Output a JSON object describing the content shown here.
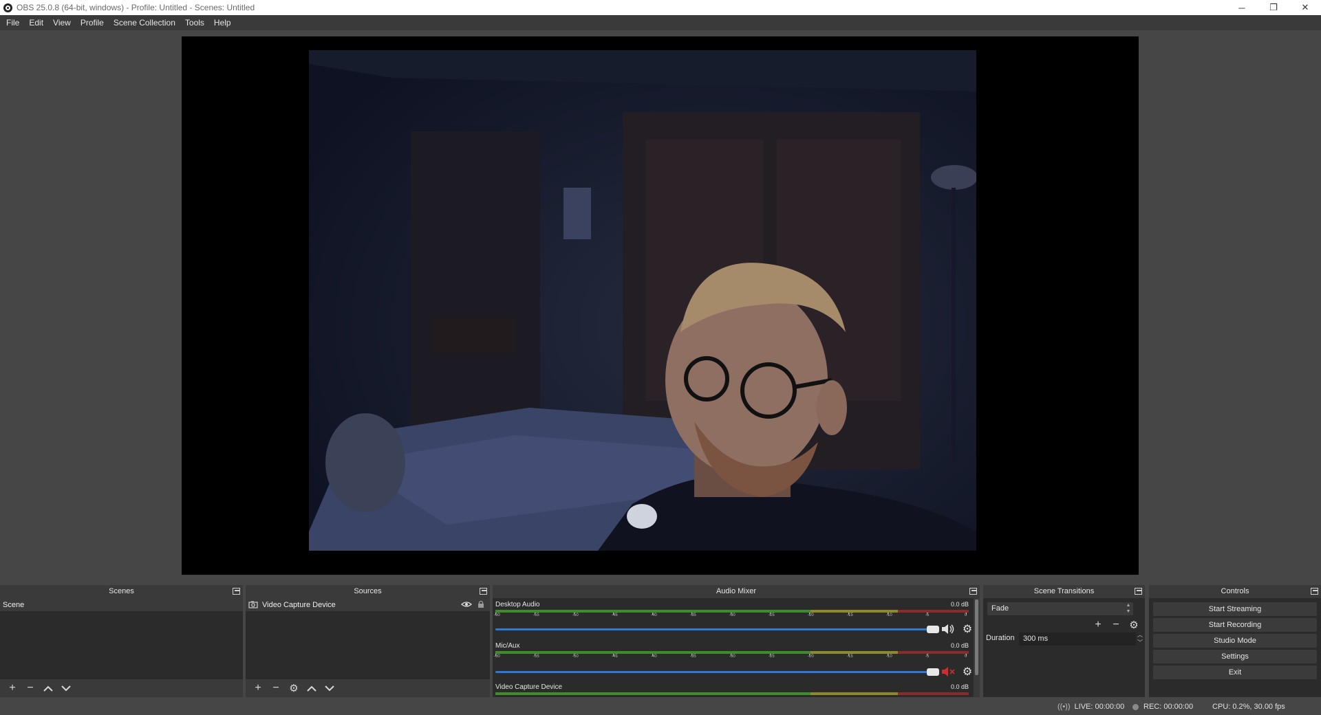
{
  "window": {
    "title": "OBS 25.0.8 (64-bit, windows) - Profile: Untitled - Scenes: Untitled",
    "minimize": "─",
    "restore": "❐",
    "close": "✕"
  },
  "menu": [
    "File",
    "Edit",
    "View",
    "Profile",
    "Scene Collection",
    "Tools",
    "Help"
  ],
  "docks": {
    "scenes": {
      "title": "Scenes",
      "items": [
        "Scene"
      ]
    },
    "sources": {
      "title": "Sources",
      "items": [
        {
          "name": "Video Capture Device",
          "visible": true,
          "locked": false
        }
      ]
    },
    "mixer": {
      "title": "Audio Mixer",
      "channels": [
        {
          "name": "Desktop Audio",
          "db": "0.0 dB",
          "muted": false,
          "volume": 1.0
        },
        {
          "name": "Mic/Aux",
          "db": "0.0 dB",
          "muted": true,
          "volume": 1.0
        },
        {
          "name": "Video Capture Device",
          "db": "0.0 dB",
          "muted": false,
          "volume": 1.0
        }
      ],
      "ticks": [
        "-60",
        "-55",
        "-50",
        "-45",
        "-40",
        "-35",
        "-30",
        "-25",
        "-20",
        "-15",
        "-10",
        "-5",
        "0"
      ]
    },
    "transitions": {
      "title": "Scene Transitions",
      "selected": "Fade",
      "duration_label": "Duration",
      "duration_value": "300 ms"
    },
    "controls": {
      "title": "Controls",
      "buttons": [
        "Start Streaming",
        "Start Recording",
        "Studio Mode",
        "Settings",
        "Exit"
      ]
    }
  },
  "status": {
    "live": "LIVE: 00:00:00",
    "rec": "REC: 00:00:00",
    "cpu": "CPU: 0.2%, 30.00 fps"
  },
  "colors": {
    "background": "#464646",
    "panel": "#2b2b2b",
    "slider": "#2f78d4",
    "muted": "#d12c2c"
  }
}
